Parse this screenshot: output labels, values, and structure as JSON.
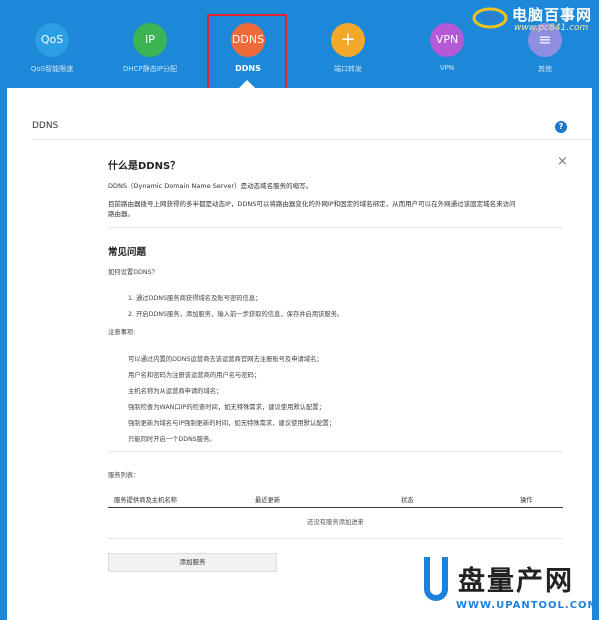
{
  "nav": {
    "items": [
      {
        "icon_text": "QoS",
        "label": "QoS智能限速",
        "color": "#2a9fe6",
        "active": false
      },
      {
        "icon_text": "IP",
        "label": "DHCP静态IP分配",
        "color": "#3cb454",
        "active": false
      },
      {
        "icon_text": "DDNS",
        "label": "DDNS",
        "color": "#ef6a3a",
        "active": true
      },
      {
        "icon_text": "+",
        "label": "端口转发",
        "color": "#f4a82a",
        "active": false
      },
      {
        "icon_text": "VPN",
        "label": "VPN",
        "color": "#b45ad6",
        "active": false
      },
      {
        "icon_text": "≡",
        "label": "其他",
        "color": "#8e8fe0",
        "active": false
      }
    ]
  },
  "logo": {
    "title": "电脑百事网",
    "url": "www.pc841.com"
  },
  "panel": {
    "section_title": "DDNS",
    "help_icon": "?",
    "close_icon": "×"
  },
  "intro": {
    "title": "什么是DDNS？",
    "p1": "DDNS（Dynamic Domain Name Server）是动态域名服务的缩写。",
    "p2_line1": "目前路由器拨号上网获得的多半都是动态IP，DDNS可以将路由器变化的外网IP和固定的域名绑定，从而用户可以在外网通过该固定域名来访问",
    "p2_line2": "路由器。"
  },
  "faq": {
    "title": "常见问题",
    "question": "如何设置DDNS？",
    "steps": [
      "1. 通过DDNS服务商获得域名及账号密码信息；",
      "2. 开启DDNS服务，添加服务，输入前一步获取的信息，保存并启用该服务。"
    ],
    "notes_title": "注意事项:",
    "notes": [
      "可以通过内置的DDNS运营商去该运营商官网去注册账号及申请域名；",
      "用户名和密码为注册该运营商的用户名与密码；",
      "主机名称为从运营商申请的域名；",
      "强制检查为WAN口IP的检查时间，如无特殊需求，建议使用默认配置；",
      "强制更新为域名与IP强制更新的时间，如无特殊需求，建议使用默认配置；",
      "只能同时开启一个DDNS服务。"
    ]
  },
  "services": {
    "title": "服务列表：",
    "columns": [
      "服务提供商及主机名称",
      "最近更新",
      "状态",
      "操作"
    ],
    "empty_text": "还没有服务添加进来",
    "add_button": "添加服务"
  },
  "watermark": {
    "title": "盘量产网",
    "url": "WWW.UPANTOOL.COM"
  }
}
